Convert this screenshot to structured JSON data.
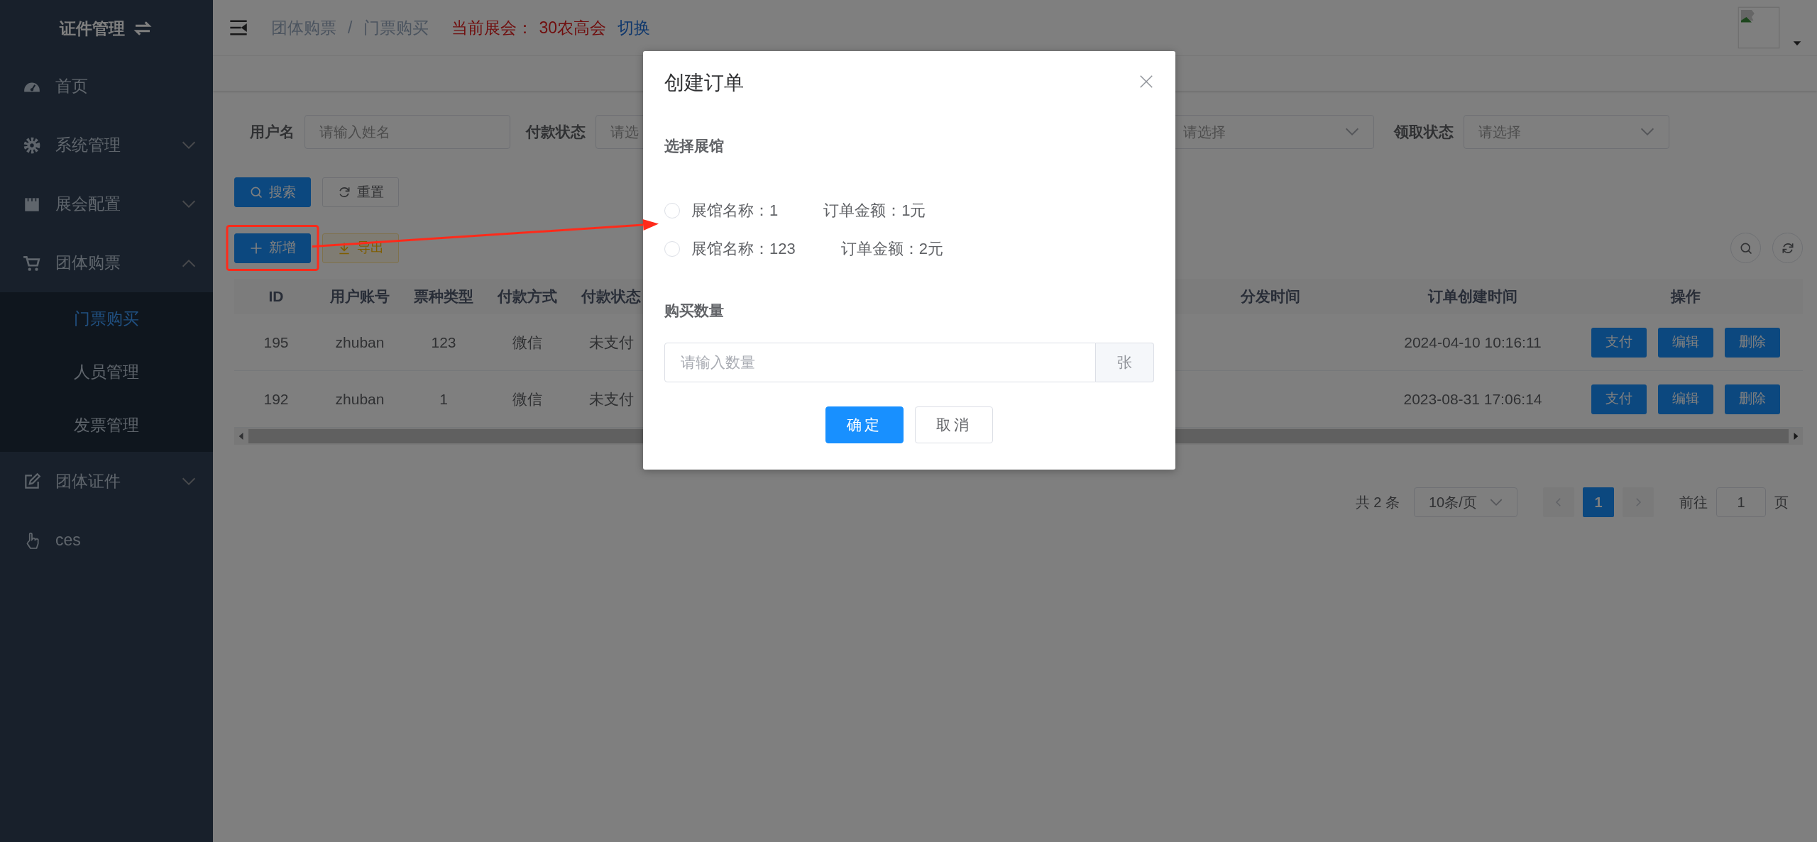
{
  "sidebar": {
    "title": "证件管理",
    "items": [
      {
        "label": "首页",
        "kind": "link"
      },
      {
        "label": "系统管理",
        "kind": "submenu",
        "expanded": false
      },
      {
        "label": "展会配置",
        "kind": "submenu",
        "expanded": false
      },
      {
        "label": "团体购票",
        "kind": "submenu",
        "expanded": true,
        "children": [
          {
            "label": "门票购买",
            "selected": true
          },
          {
            "label": "人员管理",
            "selected": false
          },
          {
            "label": "发票管理",
            "selected": false
          }
        ]
      },
      {
        "label": "团体证件",
        "kind": "submenu",
        "expanded": false
      },
      {
        "label": "ces",
        "kind": "link"
      }
    ]
  },
  "header": {
    "breadcrumb": [
      "团体购票",
      "门票购买"
    ],
    "separator": "/",
    "current_label": "当前展会：",
    "current_value": "30农高会",
    "switch_link": "切换"
  },
  "filters_left": [
    {
      "label": "用户名",
      "placeholder": "请输入姓名"
    },
    {
      "label": "付款状态",
      "placeholder": "请选"
    }
  ],
  "filters_right": [
    {
      "kind": "select",
      "placeholder": "请选择"
    },
    {
      "label": "领取状态",
      "kind": "select",
      "placeholder": "请选择"
    }
  ],
  "search_buttons": [
    "搜索",
    "重置"
  ],
  "toolbar_buttons": [
    "新增",
    "导出"
  ],
  "table": {
    "left_columns": [
      "ID",
      "用户账号",
      "票种类型",
      "付款方式",
      "付款状态"
    ],
    "right_columns": [
      "分发时间",
      "订单创建时间",
      "操作"
    ],
    "rows": [
      {
        "cells": [
          "195",
          "zhuban",
          "123",
          "微信",
          "未支付"
        ],
        "created": "2024-04-10 10:16:11",
        "actions": [
          "支付",
          "编辑",
          "删除"
        ]
      },
      {
        "cells": [
          "192",
          "zhuban",
          "1",
          "微信",
          "未支付"
        ],
        "created": "2023-08-31 17:06:14",
        "actions": [
          "支付",
          "编辑",
          "删除"
        ]
      }
    ]
  },
  "pagination": {
    "total": "共 2 条",
    "page_size": "10条/页",
    "pages": [
      {
        "label": "1",
        "selected": true
      }
    ],
    "goto_label": "前往",
    "goto_value": "1",
    "goto_suffix": "页"
  },
  "dialog": {
    "title": "创建订单",
    "hall_section": "选择展馆",
    "options": [
      {
        "name": "展馆名称：1",
        "amount": "订单金额：1元",
        "selected": false
      },
      {
        "name": "展馆名称：123",
        "amount": "订单金额：2元",
        "selected": false
      }
    ],
    "quantity_section": "购买数量",
    "quantity": {
      "placeholder": "请输入数量",
      "unit": "张"
    },
    "buttons": [
      "确定",
      "取消"
    ]
  }
}
